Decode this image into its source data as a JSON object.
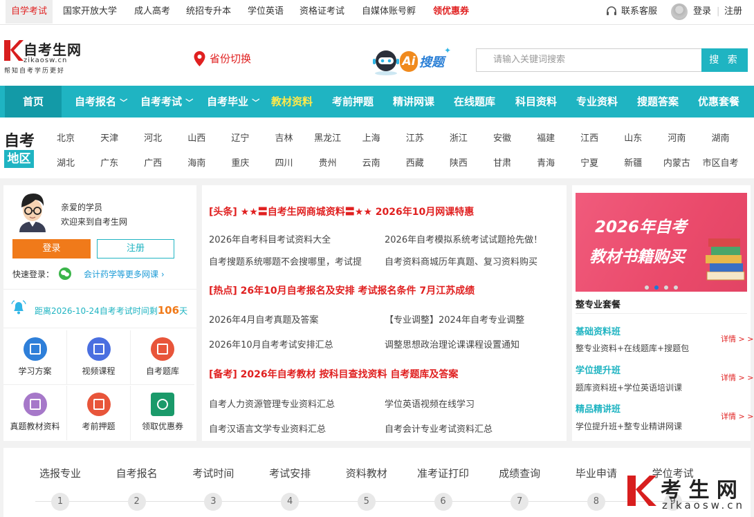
{
  "topbar": {
    "links": [
      "自学考试",
      "国家开放大学",
      "成人高考",
      "统招专升本",
      "学位英语",
      "资格证考试",
      "自媒体账号孵"
    ],
    "promo": "领优惠券",
    "service": "联系客服",
    "login": "登录",
    "register": "注册"
  },
  "header": {
    "logo_title": "自考生网",
    "logo_domain": "zikaosw.cn",
    "logo_slogan": "帮知自考学历更好",
    "province_switch": "省份切换",
    "ai_label": "搜题",
    "search_placeholder": "请输入关键词搜索",
    "search_button": "搜 索"
  },
  "nav": {
    "home": "首页",
    "items": [
      "自考报名",
      "自考考试",
      "自考毕业",
      "教材资料",
      "考前押题",
      "精讲网课",
      "在线题库",
      "科目资料",
      "专业资料",
      "搜题答案",
      "优惠套餐"
    ]
  },
  "region": {
    "logo_top": "自考",
    "logo_bottom": "地区",
    "row1": [
      "北京",
      "天津",
      "河北",
      "山西",
      "辽宁",
      "吉林",
      "黑龙江",
      "上海",
      "江苏",
      "浙江",
      "安徽",
      "福建",
      "江西",
      "山东",
      "河南",
      "湖南"
    ],
    "row2": [
      "湖北",
      "广东",
      "广西",
      "海南",
      "重庆",
      "四川",
      "贵州",
      "云南",
      "西藏",
      "陕西",
      "甘肃",
      "青海",
      "宁夏",
      "新疆",
      "内蒙古",
      "市区自考"
    ]
  },
  "user": {
    "greet1": "亲爱的学员",
    "greet2": "欢迎来到自考生网",
    "login": "登录",
    "register": "注册",
    "quick_login": "快速登录：",
    "more": "会计药学等更多网课"
  },
  "countdown": {
    "prefix": "距离2026-10-24自考考试时间剩",
    "days": "106",
    "suffix": "天"
  },
  "shortcuts": [
    {
      "label": "学习方案",
      "color": "#2e7fd9"
    },
    {
      "label": "视频课程",
      "color": "#4a6fe0"
    },
    {
      "label": "自考题库",
      "color": "#e8553a"
    },
    {
      "label": "真题教材资料",
      "color": "#a678c9"
    },
    {
      "label": "考前押题",
      "color": "#e8553a"
    },
    {
      "label": "领取优惠券",
      "color": "#1a9a6a"
    }
  ],
  "news": {
    "head1": "[头条]  ★★〓自考生网商城资料〓★★   2026年10月网课特惠",
    "items1": [
      "2026年自考科目考试资料大全",
      "2026年自考模拟系统考试试题抢先做！",
      "自考搜题系统哪题不会搜哪里，考试提",
      "自考资料商城历年真题、复习资料购买"
    ],
    "head2": "[热点]  26年10月自考报名及安排   考试报名条件   7月江苏成绩",
    "items2": [
      "2026年4月自考真题及答案",
      "【专业调整】2024年自考专业调整",
      "2026年10月自考考试安排汇总",
      "调整思想政治理论课课程设置通知"
    ],
    "head3": "[备考]  2026年自考教材   按科目查找资料   自考题库及答案",
    "items3": [
      "自考人力资源管理专业资料汇总",
      "学位英语视频在线学习",
      "自考汉语言文学专业资料汇总",
      "自考会计专业考试资料汇总"
    ]
  },
  "banner": {
    "line1": "2026年自考",
    "line2": "教材书籍购买"
  },
  "packages": {
    "title": "整专业套餐",
    "more": "详情 > >",
    "items": [
      {
        "name": "基础资料班",
        "desc": "整专业资料+在线题库+搜题包"
      },
      {
        "name": "学位提升班",
        "desc": "题库资料班+学位英语培训课"
      },
      {
        "name": "精品精讲班",
        "desc": "学位提升班+整专业精讲网课"
      }
    ]
  },
  "steps": {
    "labels": [
      "选报专业",
      "自考报名",
      "考试时间",
      "考试安排",
      "资料教材",
      "准考证打印",
      "成绩查询",
      "毕业申请",
      "学位考试"
    ],
    "numbers": [
      "1",
      "2",
      "3",
      "4",
      "5",
      "6",
      "7",
      "8",
      "9"
    ]
  },
  "watermark": {
    "title": "考 生 网",
    "domain": "zikaosw.cn"
  },
  "colors": {
    "accent": "#1fb4c2",
    "red": "#e02020",
    "orange": "#f07a1a"
  }
}
